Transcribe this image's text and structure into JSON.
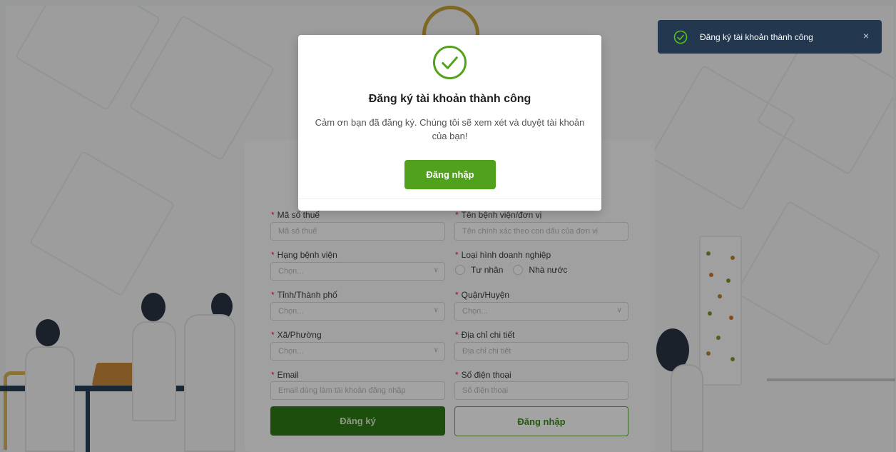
{
  "toast": {
    "message": "Đăng ký tài khoản thành công",
    "close_symbol": "×",
    "icon": "check-circle-icon"
  },
  "modal": {
    "title": "Đăng ký tài khoản thành công",
    "message_line1": "Cảm ơn bạn đã đăng ký. Chúng tôi sẽ xem xét và duyệt tài khoản",
    "message_line2": "của bạn!",
    "login_button": "Đăng nhập",
    "icon": "success-check-icon"
  },
  "form": {
    "tax_code": {
      "label": "Mã số thuế",
      "placeholder": "Mã số thuế"
    },
    "hospital_name": {
      "label": "Tên bệnh viện/đơn vị",
      "placeholder": "Tên chính xác theo con dấu của đơn vị"
    },
    "hospital_rank": {
      "label": "Hạng bệnh viện",
      "placeholder": "Chọn..."
    },
    "business_type": {
      "label": "Loại hình doanh nghiệp",
      "option_private": "Tư nhân",
      "option_state": "Nhà nước"
    },
    "province": {
      "label": "Tỉnh/Thành phố",
      "placeholder": "Chọn..."
    },
    "district": {
      "label": "Quận/Huyện",
      "placeholder": "Chọn..."
    },
    "ward": {
      "label": "Xã/Phường",
      "placeholder": "Chọn..."
    },
    "address": {
      "label": "Địa chỉ chi tiết",
      "placeholder": "Địa chỉ chi tiết"
    },
    "email": {
      "label": "Email",
      "placeholder": "Email dùng làm tài khoản đăng nhập"
    },
    "phone": {
      "label": "Số điện thoại",
      "placeholder": "Số điện thoại"
    },
    "register_button": "Đăng ký",
    "login_button": "Đăng nhập",
    "required_mark": "*",
    "select_arrow": "∨"
  },
  "colors": {
    "primary_green": "#52a11c",
    "toast_bg": "#23384f",
    "required_red": "#e23"
  }
}
